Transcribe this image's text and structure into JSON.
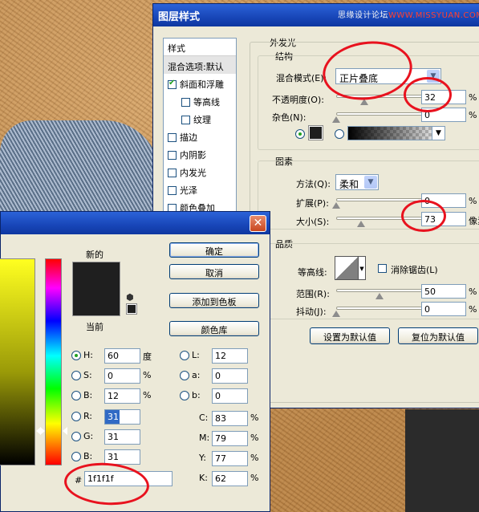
{
  "watermark": {
    "cn": "思缘设计论坛",
    "en": "WWW.MISSYUAN.COM"
  },
  "layer_style": {
    "title": "图层样式",
    "style_list": {
      "header": "样式",
      "items": [
        {
          "label": "混合选项:默认",
          "checkbox": false,
          "indent": false,
          "selected": true
        },
        {
          "label": "斜面和浮雕",
          "checkbox": true,
          "checked": true,
          "indent": false
        },
        {
          "label": "等高线",
          "checkbox": true,
          "checked": false,
          "indent": true
        },
        {
          "label": "纹理",
          "checkbox": true,
          "checked": false,
          "indent": true
        },
        {
          "label": "描边",
          "checkbox": true,
          "checked": false,
          "indent": false
        },
        {
          "label": "内阴影",
          "checkbox": true,
          "checked": false,
          "indent": false
        },
        {
          "label": "内发光",
          "checkbox": true,
          "checked": false,
          "indent": false
        },
        {
          "label": "光泽",
          "checkbox": true,
          "checked": false,
          "indent": false
        },
        {
          "label": "颜色叠加",
          "checkbox": true,
          "checked": false,
          "indent": false
        }
      ]
    },
    "section_title": "外发光",
    "structure": {
      "title": "结构",
      "blend_mode_label": "混合模式(E):",
      "blend_mode_value": "正片叠底",
      "opacity_label": "不透明度(O):",
      "opacity_value": "32",
      "opacity_unit": "%",
      "noise_label": "杂色(N):",
      "noise_value": "0",
      "noise_unit": "%",
      "opacity_level": 0.32,
      "noise_level": 0
    },
    "elements": {
      "title": "图素",
      "technique_label": "方法(Q):",
      "technique_value": "柔和",
      "spread_label": "扩展(P):",
      "spread_value": "0",
      "spread_unit": "%",
      "size_label": "大小(S):",
      "size_value": "73",
      "size_unit": "像素",
      "spread_level": 0,
      "size_level": 0.29
    },
    "quality": {
      "title": "品质",
      "contour_label": "等高线:",
      "antialias_label": "消除锯齿(L)",
      "range_label": "范围(R):",
      "range_value": "50",
      "range_unit": "%",
      "jitter_label": "抖动(J):",
      "jitter_value": "0",
      "jitter_unit": "%",
      "range_level": 0.5,
      "jitter_level": 0
    },
    "buttons": {
      "make_default": "设置为默认值",
      "reset_default": "复位为默认值"
    }
  },
  "color_picker": {
    "close": "✕",
    "new_label": "新的",
    "current_label": "当前",
    "swatch_color": "#1f1f1f",
    "buttons": {
      "ok": "确定",
      "cancel": "取消",
      "add_swatches": "添加到色板",
      "libraries": "颜色库"
    },
    "hsb": [
      {
        "label": "H:",
        "value": "60",
        "unit": "度",
        "selected": true
      },
      {
        "label": "S:",
        "value": "0",
        "unit": "%",
        "selected": false
      },
      {
        "label": "B:",
        "value": "12",
        "unit": "%",
        "selected": false
      }
    ],
    "rgb": [
      {
        "label": "R:",
        "value": "31",
        "selected": false
      },
      {
        "label": "G:",
        "value": "31",
        "selected": false
      },
      {
        "label": "B:",
        "value": "31",
        "selected": false
      }
    ],
    "lab": [
      {
        "label": "L:",
        "value": "12"
      },
      {
        "label": "a:",
        "value": "0"
      },
      {
        "label": "b:",
        "value": "0"
      }
    ],
    "cmyk": [
      {
        "label": "C:",
        "value": "83",
        "unit": "%"
      },
      {
        "label": "M:",
        "value": "79",
        "unit": "%"
      },
      {
        "label": "Y:",
        "value": "77",
        "unit": "%"
      },
      {
        "label": "K:",
        "value": "62",
        "unit": "%"
      }
    ],
    "hex_label": "#",
    "hex_value": "1f1f1f"
  },
  "annotation_color": "#e8121e"
}
